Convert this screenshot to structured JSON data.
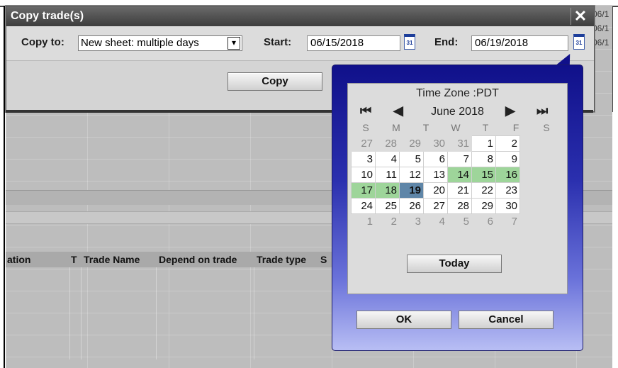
{
  "background": {
    "right_dates": [
      "06/1",
      "06/1",
      "06/1"
    ],
    "grid_headers": [
      "ation",
      "T",
      "Trade Name",
      "Depend on trade",
      "Trade type",
      "S"
    ]
  },
  "dialog": {
    "title": "Copy trade(s)",
    "close_glyph": "✕",
    "copy_to_label": "Copy to:",
    "copy_to_value": "New sheet: multiple days",
    "dropdown_arrow": "▾",
    "start_label": "Start:",
    "start_value": "06/15/2018",
    "end_label": "End:",
    "end_value": "06/19/2018",
    "calendar_icon_text": "31",
    "copy_button": "Copy"
  },
  "datepicker": {
    "timezone": "Time Zone :PDT",
    "month_label": "June 2018",
    "nav": {
      "first": "⏮",
      "prev": "◀",
      "next": "▶",
      "last": "⏭"
    },
    "weekdays": [
      "S",
      "M",
      "T",
      "W",
      "T",
      "F",
      "S"
    ],
    "weeks": [
      [
        {
          "d": "27",
          "s": "other"
        },
        {
          "d": "28",
          "s": "other"
        },
        {
          "d": "29",
          "s": "other"
        },
        {
          "d": "30",
          "s": "other"
        },
        {
          "d": "31",
          "s": "other"
        },
        {
          "d": "1",
          "s": ""
        },
        {
          "d": "2",
          "s": ""
        }
      ],
      [
        {
          "d": "3",
          "s": ""
        },
        {
          "d": "4",
          "s": ""
        },
        {
          "d": "5",
          "s": ""
        },
        {
          "d": "6",
          "s": ""
        },
        {
          "d": "7",
          "s": ""
        },
        {
          "d": "8",
          "s": ""
        },
        {
          "d": "9",
          "s": ""
        }
      ],
      [
        {
          "d": "10",
          "s": ""
        },
        {
          "d": "11",
          "s": ""
        },
        {
          "d": "12",
          "s": ""
        },
        {
          "d": "13",
          "s": ""
        },
        {
          "d": "14",
          "s": "range"
        },
        {
          "d": "15",
          "s": "range"
        },
        {
          "d": "16",
          "s": "range"
        }
      ],
      [
        {
          "d": "17",
          "s": "range"
        },
        {
          "d": "18",
          "s": "range"
        },
        {
          "d": "19",
          "s": "sel"
        },
        {
          "d": "20",
          "s": ""
        },
        {
          "d": "21",
          "s": ""
        },
        {
          "d": "22",
          "s": ""
        },
        {
          "d": "23",
          "s": ""
        }
      ],
      [
        {
          "d": "24",
          "s": ""
        },
        {
          "d": "25",
          "s": ""
        },
        {
          "d": "26",
          "s": ""
        },
        {
          "d": "27",
          "s": ""
        },
        {
          "d": "28",
          "s": ""
        },
        {
          "d": "29",
          "s": ""
        },
        {
          "d": "30",
          "s": ""
        }
      ],
      [
        {
          "d": "1",
          "s": "other"
        },
        {
          "d": "2",
          "s": "other"
        },
        {
          "d": "3",
          "s": "other"
        },
        {
          "d": "4",
          "s": "other"
        },
        {
          "d": "5",
          "s": "other"
        },
        {
          "d": "6",
          "s": "other"
        },
        {
          "d": "7",
          "s": "other"
        }
      ]
    ],
    "today_button": "Today",
    "ok_button": "OK",
    "cancel_button": "Cancel"
  },
  "colors": {
    "range_highlight": "#9ed59a",
    "selected_day": "#5f86a8",
    "popup_gradient_top": "#10108a",
    "popup_gradient_bottom": "#b8bef4",
    "title_bar": "#4a4a4a"
  }
}
